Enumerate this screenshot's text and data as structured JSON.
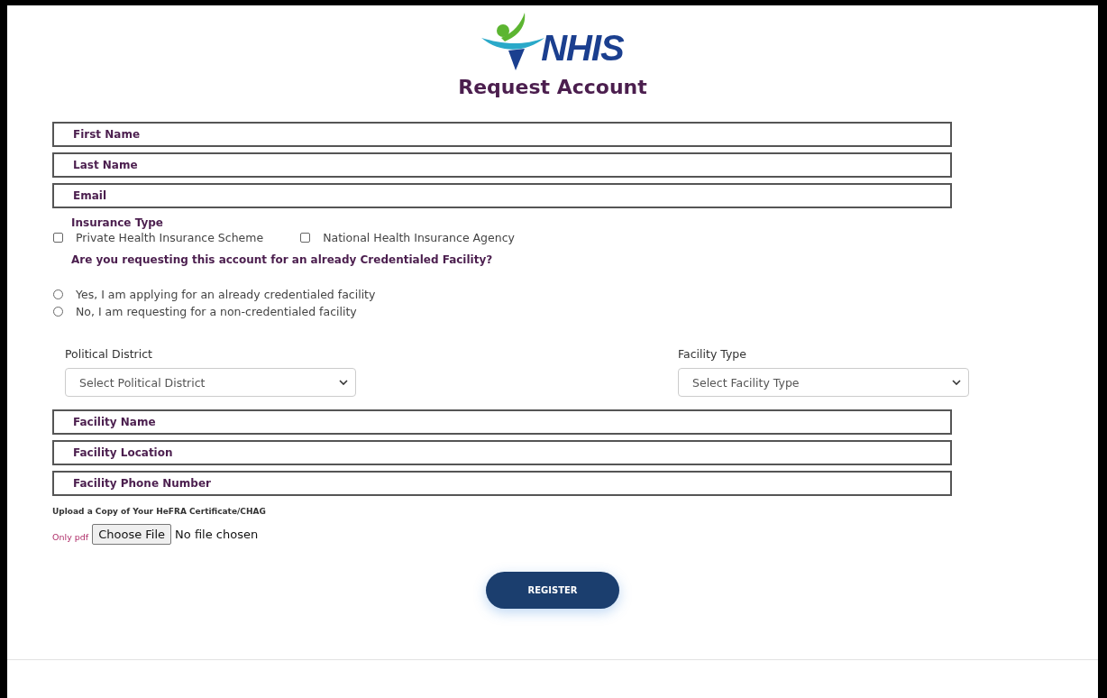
{
  "logo": {
    "text": "NHIS"
  },
  "title": "Request Account",
  "fields_top": [
    {
      "placeholder": "First Name"
    },
    {
      "placeholder": "Last Name"
    },
    {
      "placeholder": "Email"
    }
  ],
  "insurance": {
    "label": "Insurance Type",
    "options": [
      {
        "label": "Private Health Insurance Scheme",
        "checked": false
      },
      {
        "label": "National Health Insurance Agency",
        "checked": false
      }
    ]
  },
  "credential": {
    "question": "Are you requesting this account for an already Credentialed Facility?",
    "options": [
      {
        "label": "Yes, I am applying for an already credentialed facility",
        "selected": false
      },
      {
        "label": "No, I am requesting for a non-credentialed facility",
        "selected": false
      }
    ]
  },
  "selects": [
    {
      "label": "Political District",
      "value": "Select Political District"
    },
    {
      "label": "Facility Type",
      "value": "Select Facility Type"
    }
  ],
  "fields_bottom": [
    {
      "placeholder": "Facility Name"
    },
    {
      "placeholder": "Facility Location"
    },
    {
      "placeholder": "Facility Phone Number"
    }
  ],
  "upload": {
    "label": "Upload a Copy of Your HeFRA Certificate/CHAG",
    "hint": "Only pdf",
    "button": "Choose File",
    "status": "No file chosen"
  },
  "register": "REGISTER"
}
